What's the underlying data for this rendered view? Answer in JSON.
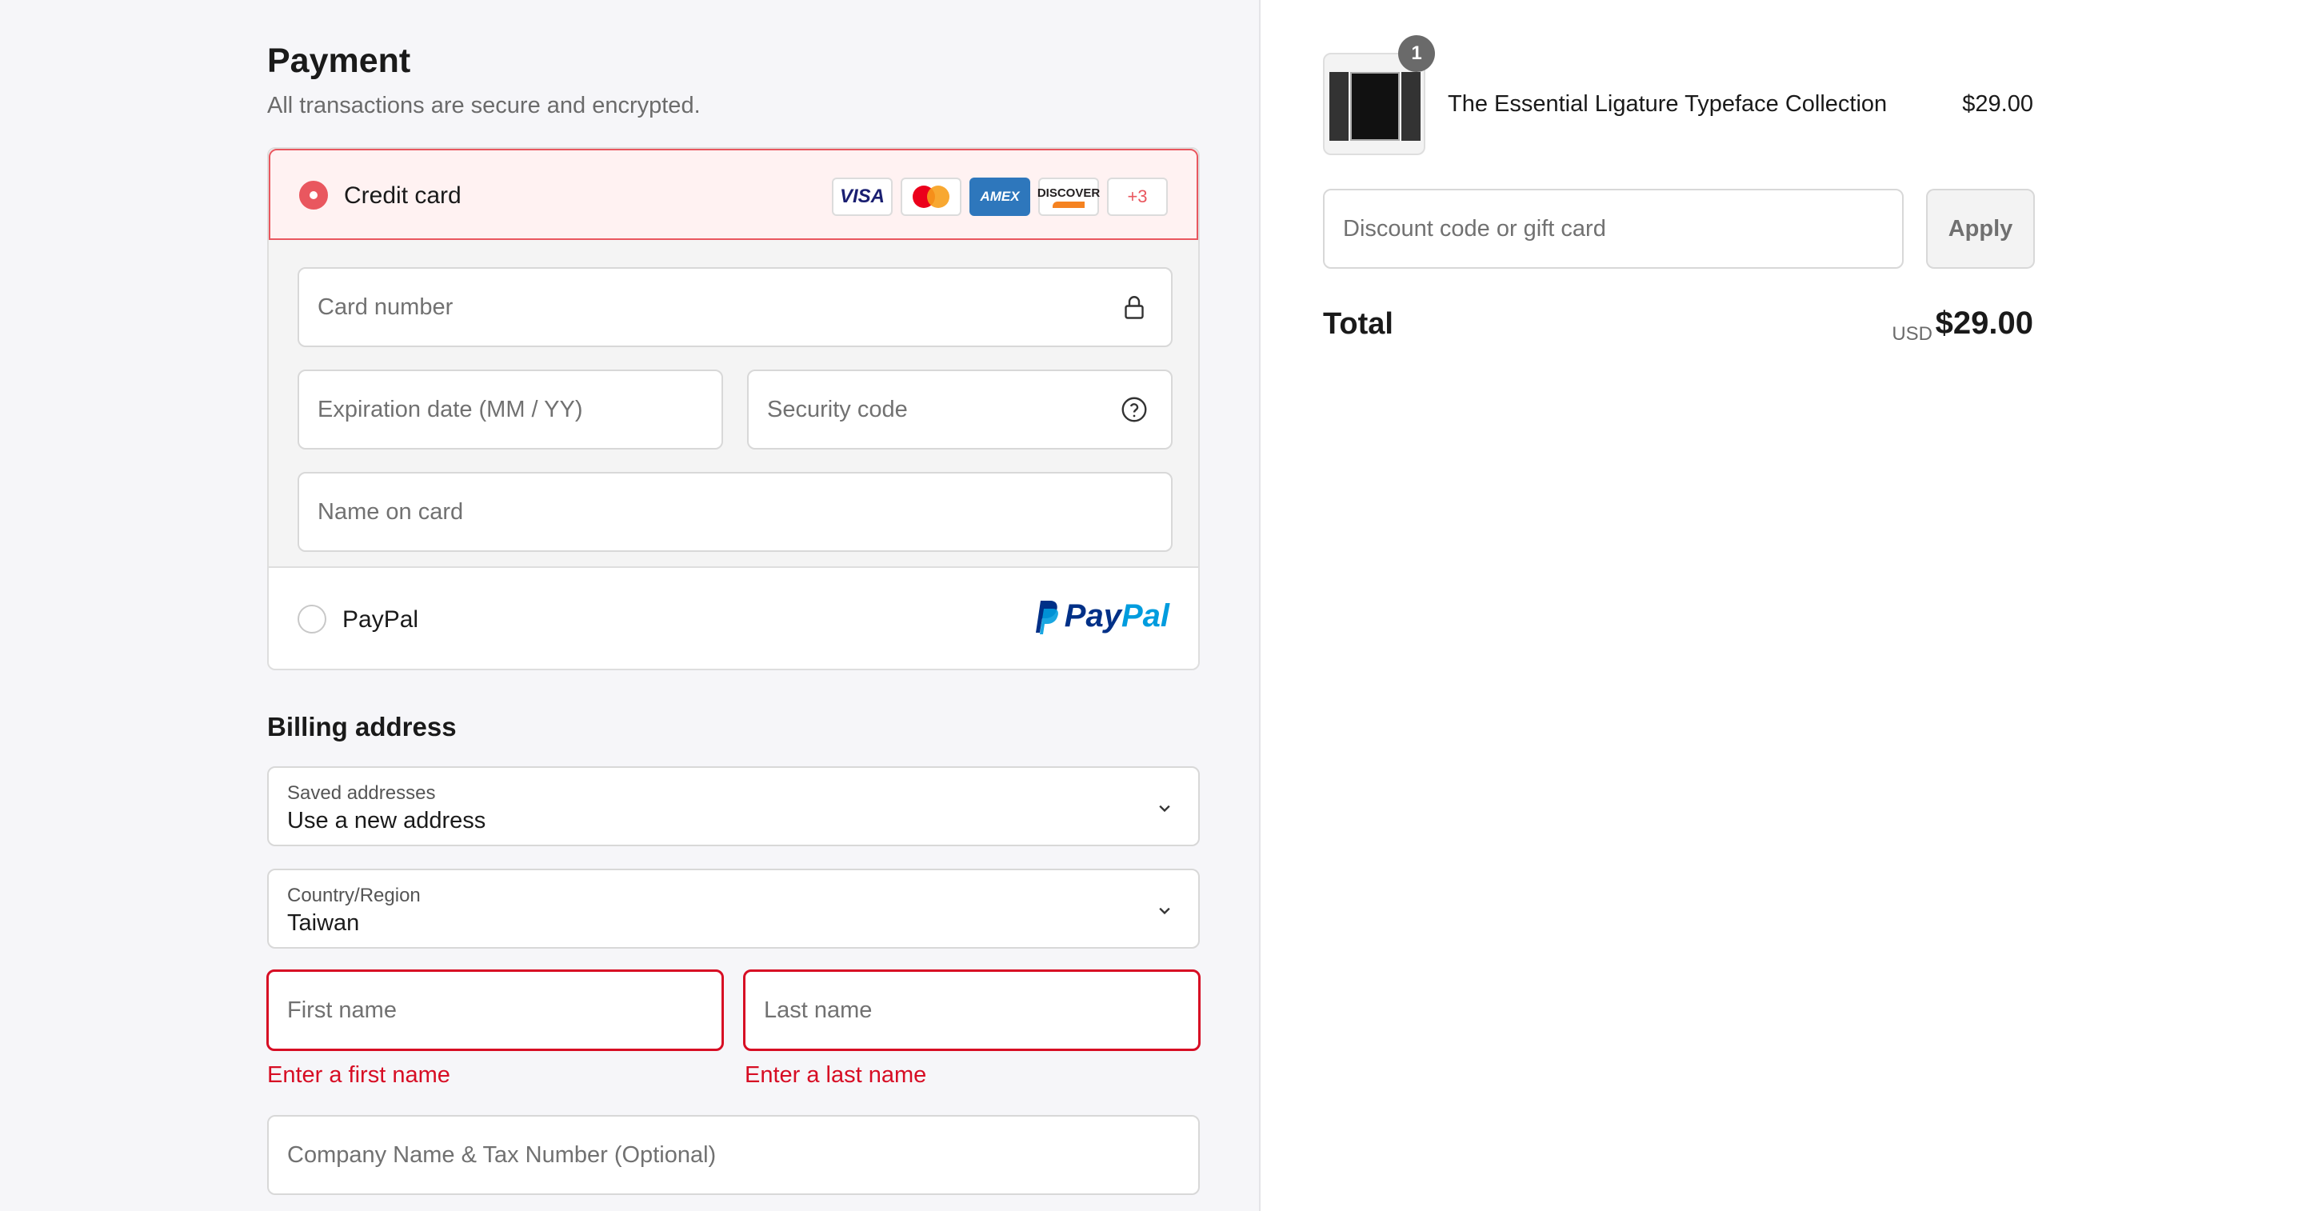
{
  "payment": {
    "title": "Payment",
    "subtitle": "All transactions are secure and encrypted.",
    "methods": {
      "credit_card": {
        "label": "Credit card",
        "logos": [
          "VISA",
          "Mastercard",
          "AMEX",
          "DISCOVER",
          "+3"
        ],
        "more_label": "+3"
      },
      "paypal": {
        "label": "PayPal",
        "logo_pay": "Pay",
        "logo_pal": "Pal"
      }
    },
    "fields": {
      "card_number": "Card number",
      "expiration": "Expiration date (MM / YY)",
      "security_code": "Security code",
      "name_on_card": "Name on card"
    },
    "icons": {
      "card_number": "lock-icon",
      "security_code": "help-circle-icon"
    }
  },
  "billing": {
    "title": "Billing address",
    "saved_addresses": {
      "label": "Saved addresses",
      "value": "Use a new address"
    },
    "country": {
      "label": "Country/Region",
      "value": "Taiwan"
    },
    "first_name": {
      "placeholder": "First name",
      "error": "Enter a first name"
    },
    "last_name": {
      "placeholder": "Last name",
      "error": "Enter a last name"
    },
    "company": {
      "placeholder": "Company Name & Tax Number (Optional)"
    }
  },
  "summary": {
    "product": {
      "quantity": "1",
      "title": "The Essential Ligature Typeface Collection",
      "price": "$29.00"
    },
    "discount": {
      "placeholder": "Discount code or gift card",
      "apply_label": "Apply"
    },
    "total": {
      "label": "Total",
      "currency": "USD",
      "value": "$29.00"
    }
  },
  "colors": {
    "accent": "#e9575f",
    "error": "#d70d24",
    "selected_bg": "#fff2f2"
  }
}
